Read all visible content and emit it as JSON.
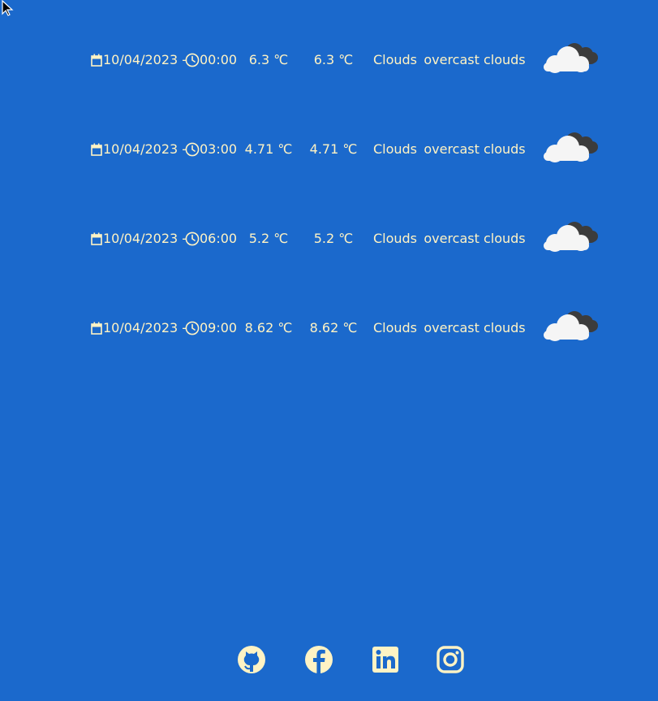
{
  "forecast": [
    {
      "date": "10/04/2023 -",
      "time": "00:00",
      "temp": "6.3 ℃",
      "feels_like": "6.3 ℃",
      "main": "Clouds",
      "description": "overcast clouds",
      "icon": "overcast-clouds-icon"
    },
    {
      "date": "10/04/2023 -",
      "time": "03:00",
      "temp": "4.71 ℃",
      "feels_like": "4.71 ℃",
      "main": "Clouds",
      "description": "overcast clouds",
      "icon": "overcast-clouds-icon"
    },
    {
      "date": "10/04/2023 -",
      "time": "06:00",
      "temp": "5.2 ℃",
      "feels_like": "5.2 ℃",
      "main": "Clouds",
      "description": "overcast clouds",
      "icon": "overcast-clouds-icon"
    },
    {
      "date": "10/04/2023 -",
      "time": "09:00",
      "temp": "8.62 ℃",
      "feels_like": "8.62 ℃",
      "main": "Clouds",
      "description": "overcast clouds",
      "icon": "overcast-clouds-icon"
    }
  ],
  "footer": {
    "links": [
      "github-icon",
      "facebook-icon",
      "linkedin-icon",
      "instagram-icon"
    ]
  },
  "colors": {
    "background": "#1b69cc",
    "text": "#fff3c4",
    "cloud_light": "#f5f5f5",
    "cloud_dark": "#3c3c3c"
  }
}
